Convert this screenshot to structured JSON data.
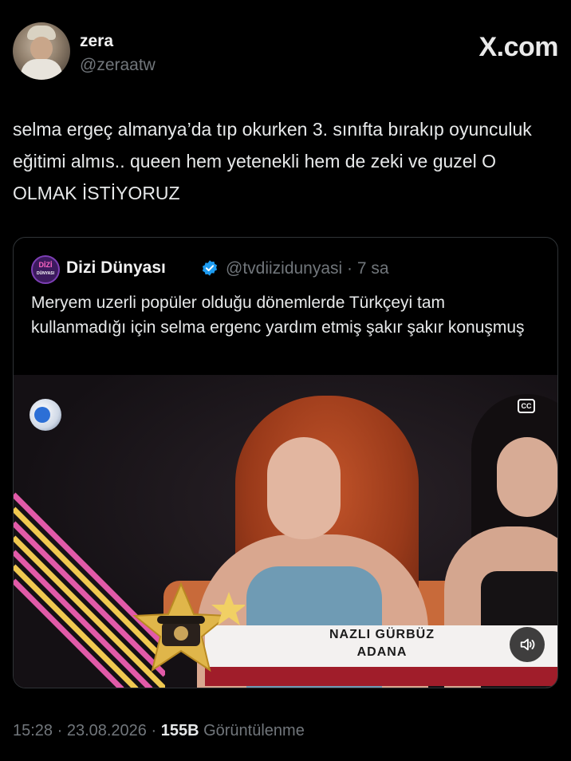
{
  "header": {
    "display_name": "zera",
    "handle": "@zeraatw",
    "brand": "X.com"
  },
  "tweet": {
    "text": "selma ergeç almanya’da tıp okurken 3. sınıfta bırakıp oyunculuk eğitimi almıs.. queen hem yetenekli hem de zeki ve guzel O OLMAK İSTİYORUZ"
  },
  "quote": {
    "logo_line1": "DİZİ",
    "logo_line2": "DÜNYASI",
    "display_name": "Dizi Dünyası",
    "handle_time": "@tvdiizidunyasi · 7 sa",
    "text": "Meryem uzerli popüler olduğu dönemlerde Türkçeyi tam kullanmadığı için selma ergenc yardım etmiş şakır şakır konuşmuş",
    "video": {
      "caption_line1": "NAZLI GÜRBÜZ",
      "caption_line2": "ADANA",
      "cc_label": "CC"
    }
  },
  "footer": {
    "timestamp": "15:28 · 23.08.2026 · ",
    "views_count": "155B",
    "views_label": " Görüntülenme"
  },
  "colors": {
    "background": "#000000",
    "text": "#e7e9ea",
    "muted": "#71767b",
    "verified": "#1d9bf0",
    "border": "#2f3336"
  }
}
